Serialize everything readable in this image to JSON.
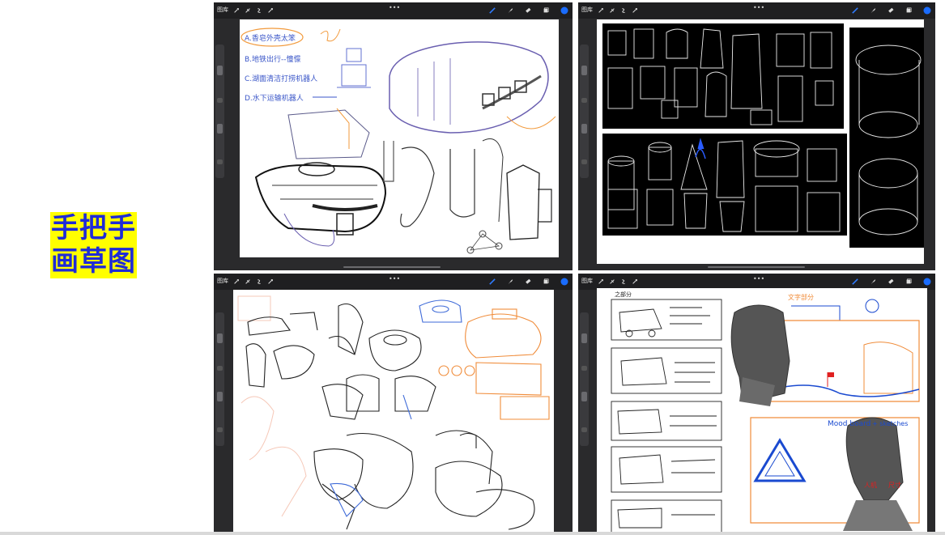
{
  "title": {
    "line1": "手把手",
    "line2": "画草图"
  },
  "app": {
    "gallery_label": "图库",
    "more_dots": "•••",
    "accent_color": "#1a6cff",
    "toolbar_right": [
      "brush-icon",
      "smudge-icon",
      "eraser-icon",
      "layers-icon",
      "color-icon"
    ],
    "toolbar_left": [
      "wrench-icon",
      "adjust-icon",
      "select-icon",
      "transform-icon"
    ]
  },
  "panels": [
    {
      "id": "panel-1",
      "notes": [
        "A.香皂外壳太笨",
        "B.地铁出行--憧憬",
        "C.湖面清洁打捞机器人",
        "D.水下运输机器人"
      ]
    },
    {
      "id": "panel-2",
      "notes": []
    },
    {
      "id": "panel-3",
      "notes": []
    },
    {
      "id": "panel-4",
      "notes": [
        "之部分",
        "文字部分",
        "Mood board",
        "+ sketches",
        "人机",
        "尺寸"
      ]
    }
  ]
}
